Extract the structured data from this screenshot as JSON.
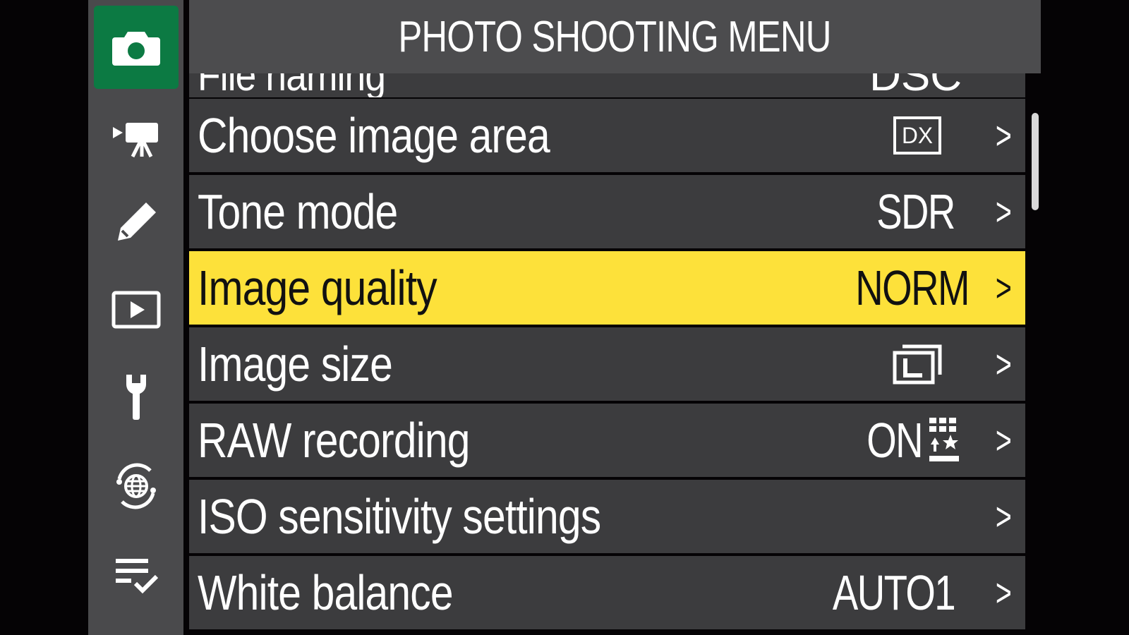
{
  "header": {
    "title": "PHOTO SHOOTING MENU"
  },
  "tabs": [
    {
      "icon": "camera-icon",
      "active": true
    },
    {
      "icon": "movie-camera-icon",
      "active": false
    },
    {
      "icon": "pencil-icon",
      "active": false
    },
    {
      "icon": "playback-icon",
      "active": false
    },
    {
      "icon": "wrench-icon",
      "active": false
    },
    {
      "icon": "network-globe-icon",
      "active": false
    },
    {
      "icon": "my-menu-checklist-icon",
      "active": false
    }
  ],
  "menu": {
    "partial_item": {
      "label": "File naming",
      "value": "DSC"
    },
    "items": [
      {
        "label": "Choose image area",
        "value": "DX",
        "value_icon": "dx-badge-icon",
        "selected": false
      },
      {
        "label": "Tone mode",
        "value": "SDR",
        "selected": false
      },
      {
        "label": "Image quality",
        "value": "NORM",
        "selected": true
      },
      {
        "label": "Image size",
        "value": "",
        "value_icon": "image-size-large-icon",
        "selected": false
      },
      {
        "label": "RAW recording",
        "value": "ON",
        "value_icon": "raw-recording-grid-star-icon",
        "selected": false
      },
      {
        "label": "ISO sensitivity settings",
        "value": "",
        "selected": false
      },
      {
        "label": "White balance",
        "value": "AUTO1",
        "selected": false
      }
    ],
    "chevron": ">"
  },
  "colors": {
    "background": "#050305",
    "panel": "#3c3c3e",
    "tab_strip": "#4a4a4c",
    "active_tab": "#0c7a43",
    "selected_row": "#fde13a"
  }
}
